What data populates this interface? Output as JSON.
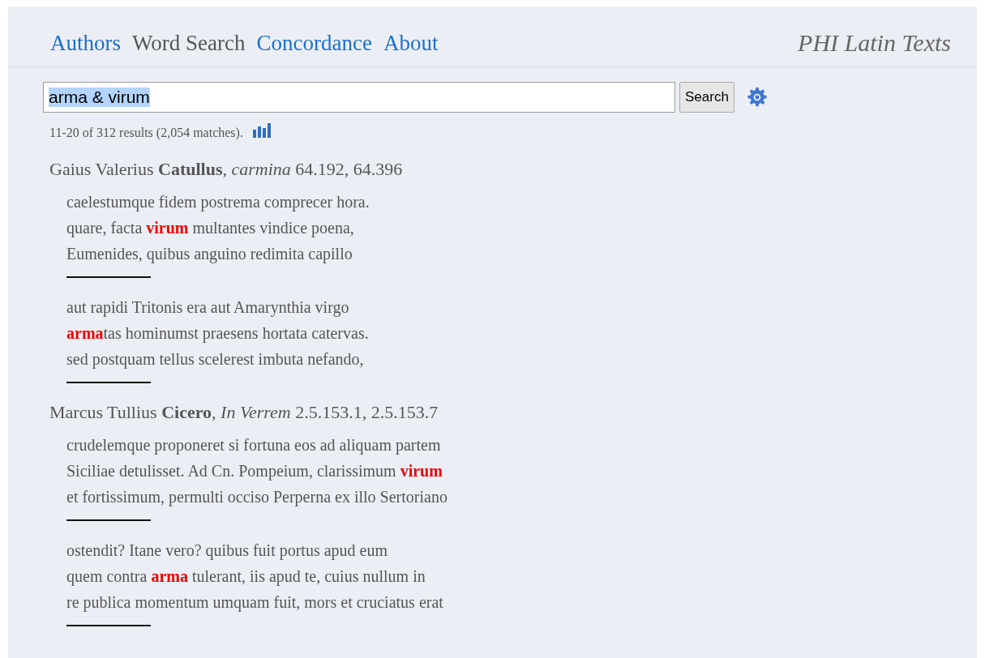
{
  "nav": [
    {
      "label": "Authors",
      "selected": false
    },
    {
      "label": "Word Search",
      "selected": true
    },
    {
      "label": "Concordance",
      "selected": false
    },
    {
      "label": "About",
      "selected": false
    }
  ],
  "site_title": "PHI Latin Texts",
  "search": {
    "value": "arma & virum",
    "value_selected": true,
    "button": "Search"
  },
  "summary": "11-20 of 312 results (2,054 matches).",
  "results": [
    {
      "heading": "Gaius Valerius **Catullus**, *carmina* 64.192, 64.396",
      "passages": [
        [
          "caelestumque fidem postrema comprecer hora.",
          "quare, facta **virum** multantes vindice poena,",
          "Eumenides, quibus anguino redimita capillo"
        ],
        [
          "aut rapidi Tritonis era aut Amarynthia virgo",
          "**arma**tas hominumst praesens hortata catervas.",
          "sed postquam tellus scelerest imbuta nefando,"
        ]
      ]
    },
    {
      "heading": "Marcus Tullius **Cicero**, *In Verrem* 2.5.153.1, 2.5.153.7",
      "passages": [
        [
          "crudelemque proponeret si fortuna eos ad aliquam partem",
          "Siciliae detulisset. Ad Cn. Pompeium, clarissimum **virum**",
          "et fortissimum, permulti occiso Perperna ex illo Sertoriano"
        ],
        [
          "ostendit? Itane vero? quibus fuit portus apud eum",
          "quem contra **arma** tulerant, iis apud te, cuius nullum in",
          "re publica momentum umquam fuit, mors et cruciatus erat"
        ]
      ]
    }
  ]
}
